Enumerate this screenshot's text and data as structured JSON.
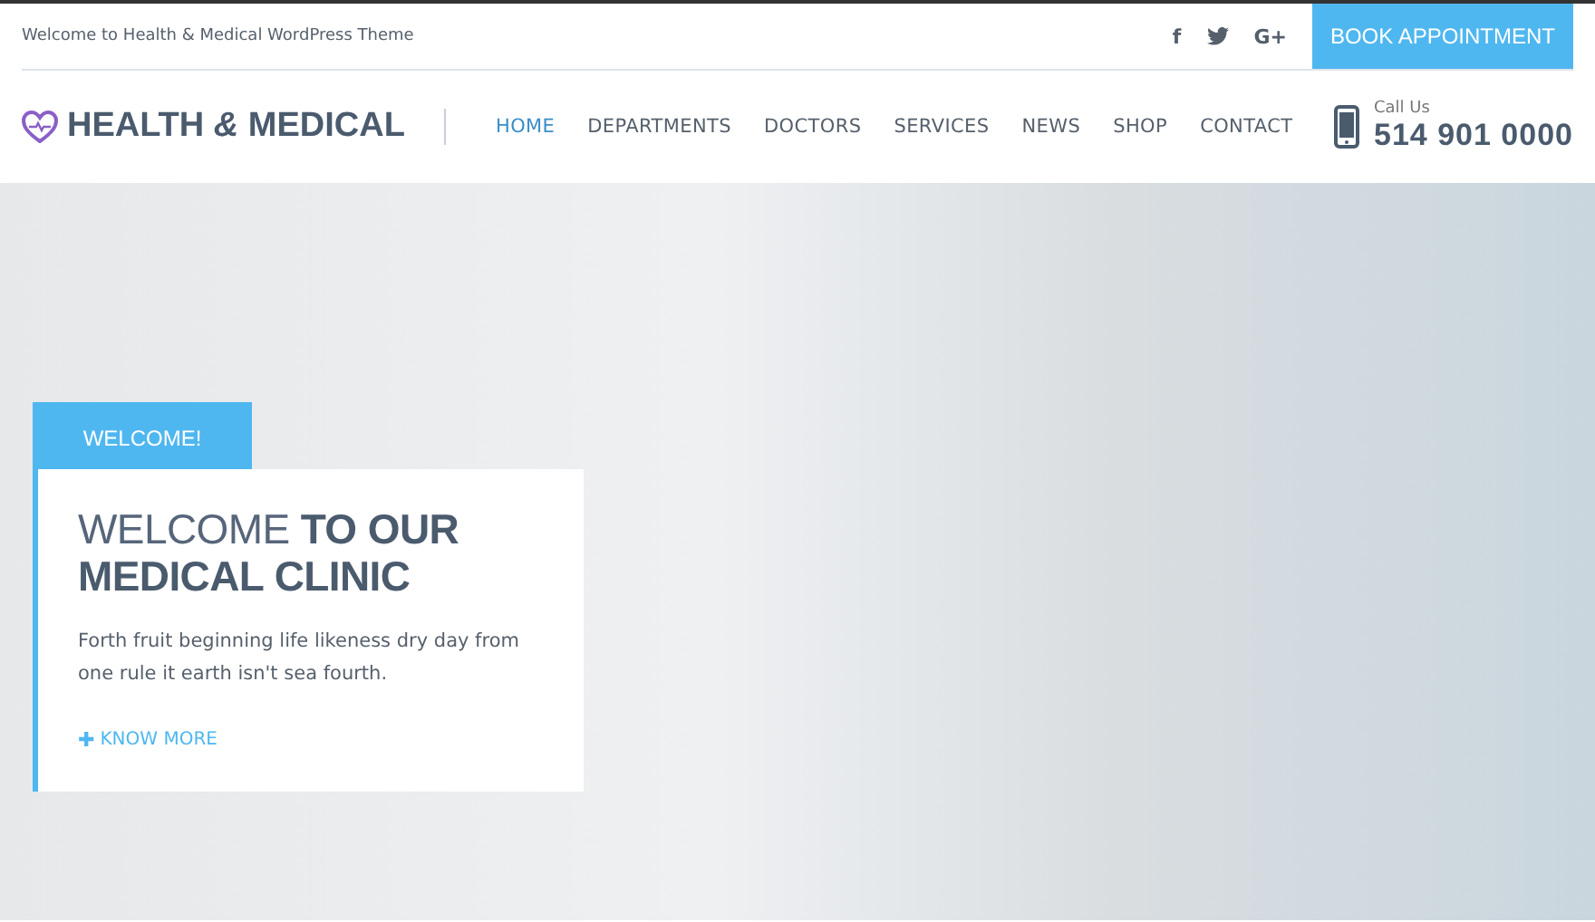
{
  "topbar": {
    "welcome": "Welcome to Health & Medical WordPress Theme",
    "social": [
      {
        "kind": "glyph",
        "text": "f"
      },
      {
        "kind": "bird"
      },
      {
        "kind": "glyph",
        "text": "G+"
      }
    ],
    "button": "BOOK APPOINTMENT"
  },
  "header": {
    "logo": "HEALTH *&* MEDICAL",
    "nav": [
      {
        "label": "HOME",
        "selected": true
      },
      {
        "label": "DEPARTMENTS",
        "selected": false
      },
      {
        "label": "DOCTORS",
        "selected": false
      },
      {
        "label": "SERVICES",
        "selected": false
      },
      {
        "label": "NEWS",
        "selected": false
      },
      {
        "label": "SHOP",
        "selected": false
      },
      {
        "label": "CONTACT",
        "selected": false
      }
    ],
    "call_label": "Call Us",
    "phone": "514 901 0000"
  },
  "hero": {
    "tab": "WELCOME!",
    "heading": "WELCOME **TO OUR MEDICAL CLINIC**",
    "text": "Forth fruit beginning life likeness dry day from one rule it earth isn't sea fourth.",
    "link_icon": "✚",
    "link": "KNOW MORE"
  }
}
